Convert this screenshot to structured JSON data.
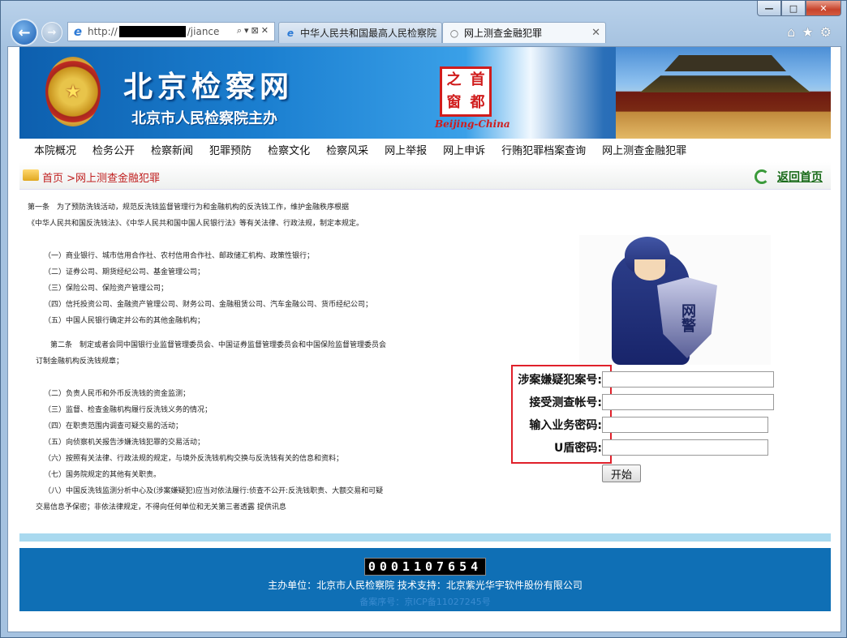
{
  "browser": {
    "address": "http://",
    "address_tail": "/jiance",
    "tabs": [
      {
        "label": "中华人民共和国最高人民检察院"
      },
      {
        "label": "网上测查金融犯罪"
      }
    ],
    "window_buttons": {
      "minimize": "—",
      "maximize": "□",
      "close": "✕"
    }
  },
  "banner": {
    "title": "北京检察网",
    "subtitle": "北京市人民检察院主办",
    "seal_chars": [
      "之",
      "首",
      "窗",
      "都"
    ],
    "seal_en": "Beijing-China"
  },
  "menu": [
    "本院概况",
    "检务公开",
    "检察新闻",
    "犯罪预防",
    "检察文化",
    "检察风采",
    "网上举报",
    "网上申诉",
    "行贿犯罪档案查询",
    "网上测查金融犯罪"
  ],
  "breadcrumb": {
    "home": "首页",
    "sep": " >",
    "current": "网上测查金融犯罪",
    "back_home": "返回首页"
  },
  "article": {
    "lines": [
      "第一条　为了预防洗钱活动，规范反洗钱监督管理行为和金融机构的反洗钱工作，维护金融秩序根据",
      "《中华人民共和国反洗钱法》、《中华人民共和国中国人民银行法》等有关法律、行政法规，制定本规定。",
      "（一）商业银行、城市信用合作社、农村信用合作社、邮政储汇机构、政策性银行；",
      "（二）证券公司、期货经纪公司、基金管理公司；",
      "（三）保险公司、保险资产管理公司；",
      "（四）信托投资公司、金融资产管理公司、财务公司、金融租赁公司、汽车金融公司、货币经纪公司；",
      "（五）中国人民银行确定并公布的其他金融机构；",
      "第二条　制定或者会同中国银行业监督管理委员会、中国证券监督管理委员会和中国保险监督管理委员会",
      "订制金融机构反洗钱规章；",
      "（二）负责人民币和外币反洗钱的资金监测；",
      "（三）监督、检查金融机构履行反洗钱义务的情况；",
      "（四）在职责范围内调查可疑交易的活动；",
      "（五）向侦察机关报告涉嫌洗钱犯罪的交易活动；",
      "（六）按照有关法律、行政法规的规定，与境外反洗钱机构交换与反洗钱有关的信息和资料；",
      "（七）国务院规定的其他有关职责。",
      "（八）中国反洗钱监测分析中心及(涉案嫌疑犯)应当对依法履行:侦查不公开:反洗钱职责、大额交易和可疑",
      "交易信息予保密；非依法律规定，不得向任何单位和无关第三者透露  提供讯息"
    ],
    "badge": "网警"
  },
  "form": {
    "case_label": "涉案嫌疑犯案号:",
    "account_label": "接受测查帐号:",
    "password_label": "输入业务密码:",
    "ukey_label": "U盾密码:",
    "start_label": "开始"
  },
  "footer": {
    "counter": "0001107654",
    "sponsor": "主办单位：北京市人民检察院  技术支持：北京紫光华宇软件股份有限公司",
    "icp": "备案序号：京ICP备11027245号"
  }
}
